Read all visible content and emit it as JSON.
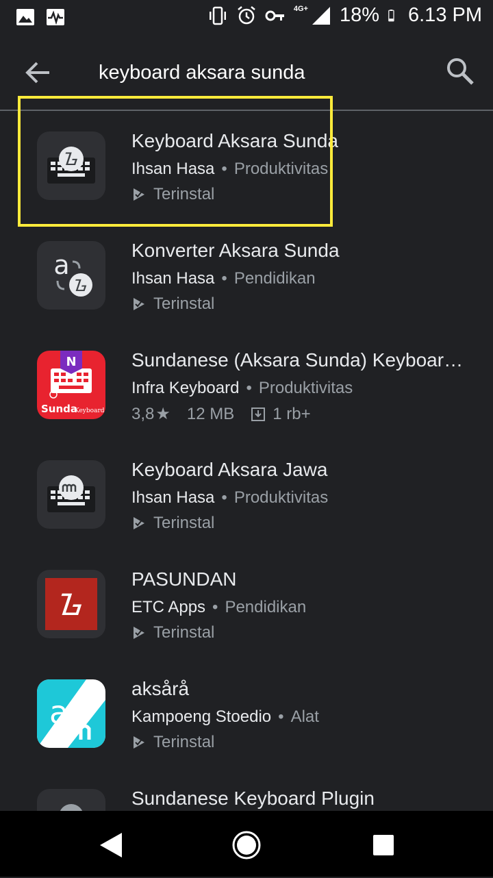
{
  "status_bar": {
    "network": "4G+",
    "battery": "18%",
    "time": "6.13 PM"
  },
  "search": {
    "query": "keyboard aksara sunda"
  },
  "apps": [
    {
      "title": "Keyboard Aksara Sunda",
      "developer": "Ihsan Hasa",
      "category": "Produktivitas",
      "status": "Terinstal"
    },
    {
      "title": "Konverter Aksara Sunda",
      "developer": "Ihsan Hasa",
      "category": "Pendidikan",
      "status": "Terinstal"
    },
    {
      "title": "Sundanese (Aksara Sunda) Keyboard : Infra Keyboard",
      "developer": "Infra Keyboard",
      "category": "Produktivitas",
      "rating": "3,8",
      "size": "12 MB",
      "downloads": "1 rb+",
      "icon_text": "Sunda",
      "icon_subtext": "Keyboard"
    },
    {
      "title": "Keyboard Aksara Jawa",
      "developer": "Ihsan Hasa",
      "category": "Produktivitas",
      "status": "Terinstal"
    },
    {
      "title": "PASUNDAN",
      "developer": "ETC Apps",
      "category": "Pendidikan",
      "status": "Terinstal"
    },
    {
      "title": "aksårå",
      "developer": "Kampoeng Stoedio",
      "category": "Alat",
      "status": "Terinstal"
    },
    {
      "title": "Sundanese Keyboard Plugin"
    }
  ],
  "colors": {
    "background": "#202124",
    "highlight_border": "#ffeb3b",
    "infra_red": "#e8232f",
    "pasundan_red": "#b3261e",
    "aksara_cyan": "#1ec8d8"
  }
}
